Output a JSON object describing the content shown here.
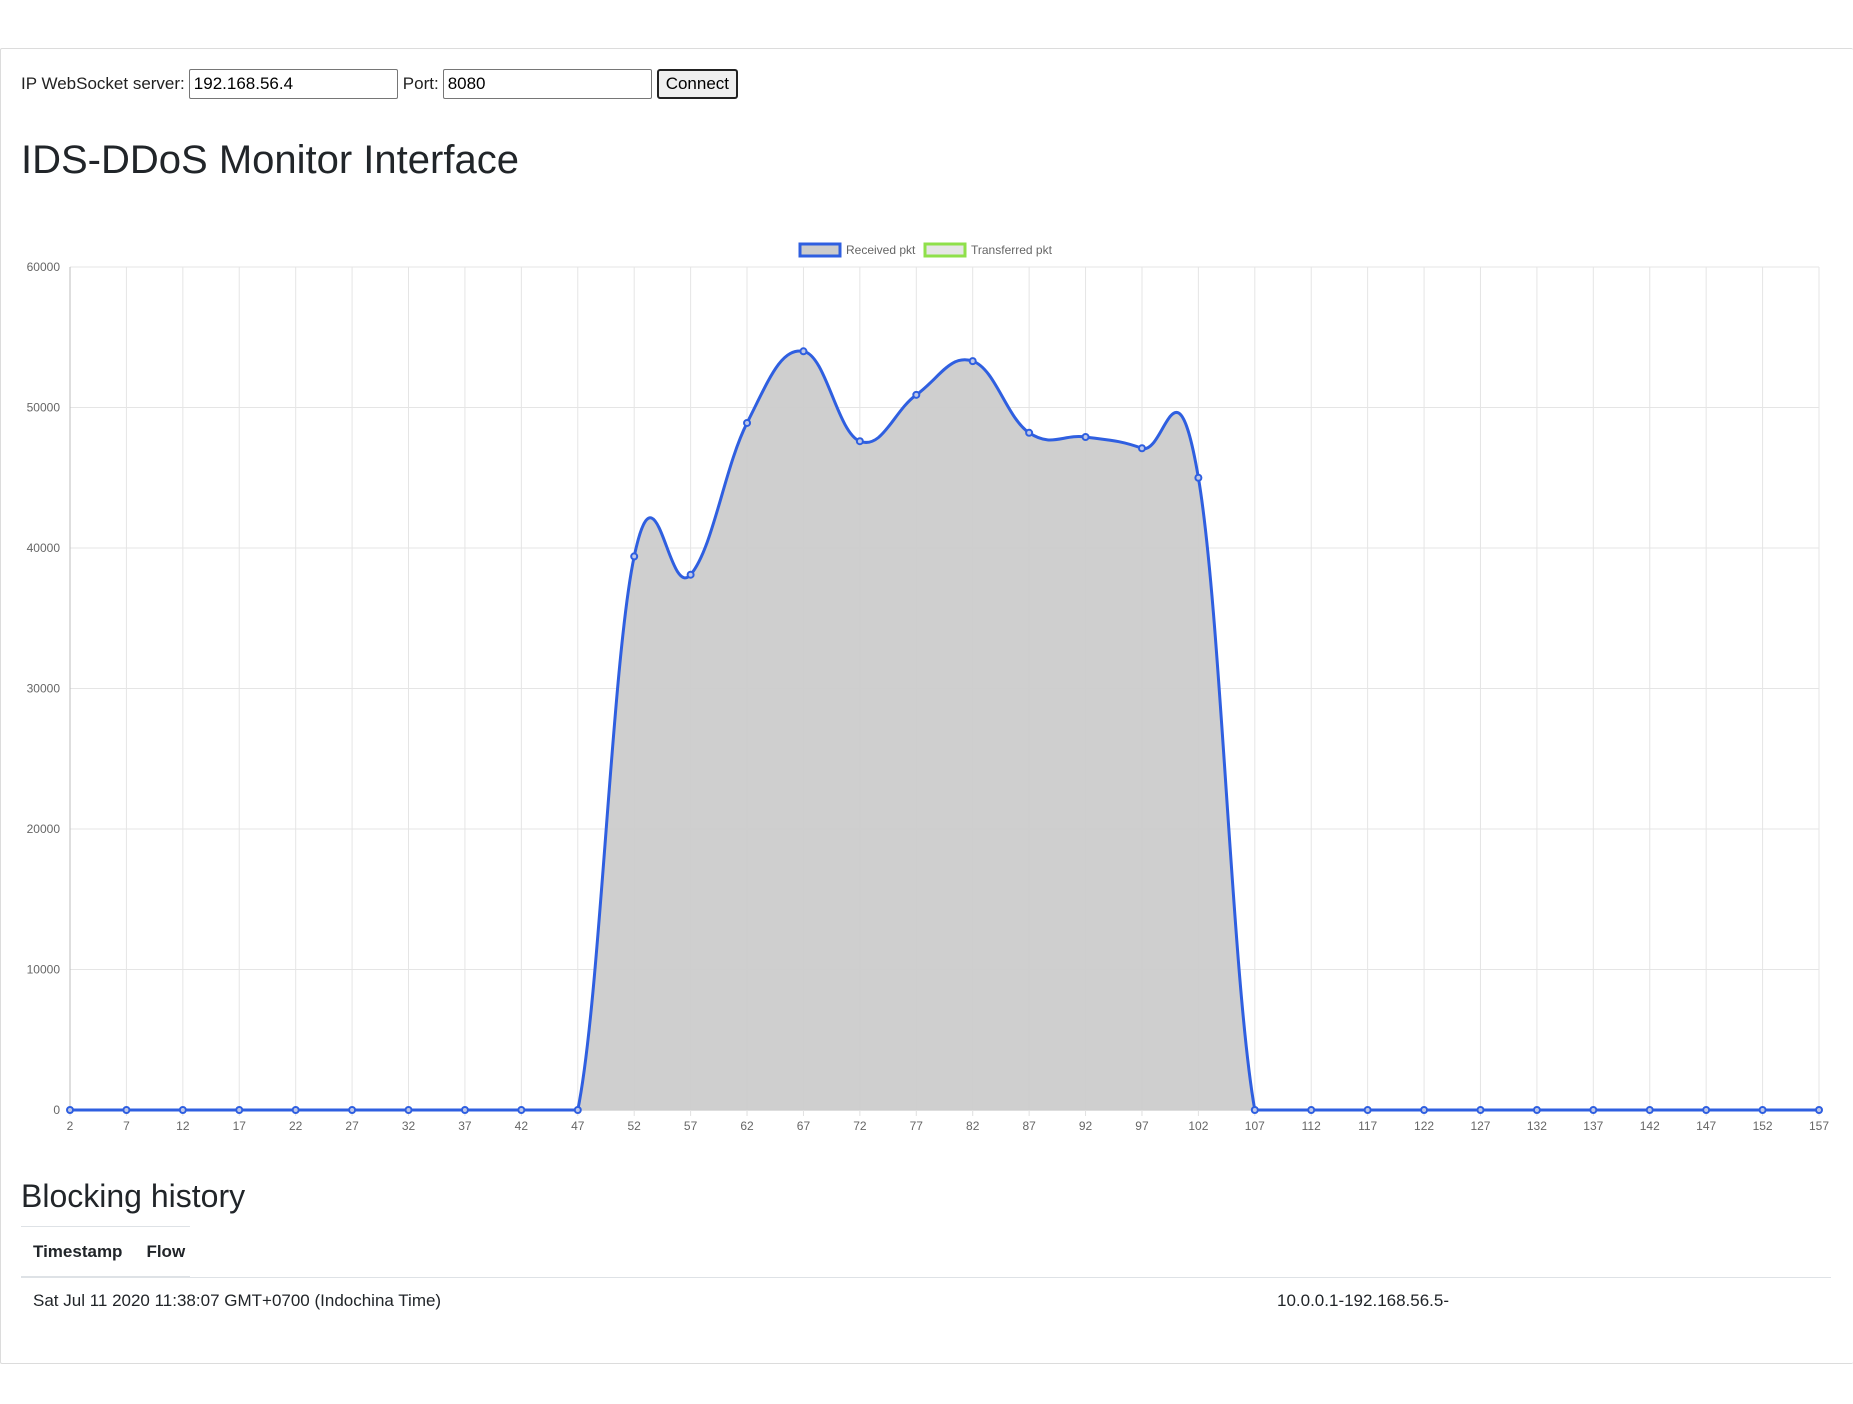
{
  "connection": {
    "ip_label": "IP WebSocket server:",
    "ip_value": "192.168.56.4",
    "port_label": "Port:",
    "port_value": "8080",
    "connect_label": "Connect"
  },
  "page_title": "IDS-DDoS Monitor Interface",
  "chart_data": {
    "type": "line",
    "title": "",
    "xlabel": "",
    "ylabel": "",
    "ylim": [
      0,
      60000
    ],
    "yticks": [
      0,
      10000,
      20000,
      30000,
      40000,
      50000,
      60000
    ],
    "x": [
      2,
      7,
      12,
      17,
      22,
      27,
      32,
      37,
      42,
      47,
      52,
      57,
      62,
      67,
      72,
      77,
      82,
      87,
      92,
      97,
      102,
      107,
      112,
      117,
      122,
      127,
      132,
      137,
      142,
      147,
      152,
      157
    ],
    "legend_position": "top-center",
    "grid": true,
    "series": [
      {
        "name": "Received pkt",
        "color": "#2f5fe0",
        "fill": "#cccccc",
        "values": [
          0,
          0,
          0,
          0,
          0,
          0,
          0,
          0,
          0,
          0,
          39400,
          38100,
          48900,
          54000,
          47600,
          50900,
          53300,
          48200,
          47900,
          47100,
          45000,
          0,
          0,
          0,
          0,
          0,
          0,
          0,
          0,
          0,
          0,
          0
        ]
      },
      {
        "name": "Transferred pkt",
        "color": "#8fe04a",
        "fill": "#e6e6e6",
        "values": []
      }
    ]
  },
  "history": {
    "title": "Blocking history",
    "col_timestamp": "Timestamp",
    "col_flow": "Flow",
    "rows": [
      {
        "timestamp": "Sat Jul 11 2020 11:38:07 GMT+0700 (Indochina Time)",
        "flow": "10.0.0.1-192.168.56.5-"
      }
    ]
  }
}
